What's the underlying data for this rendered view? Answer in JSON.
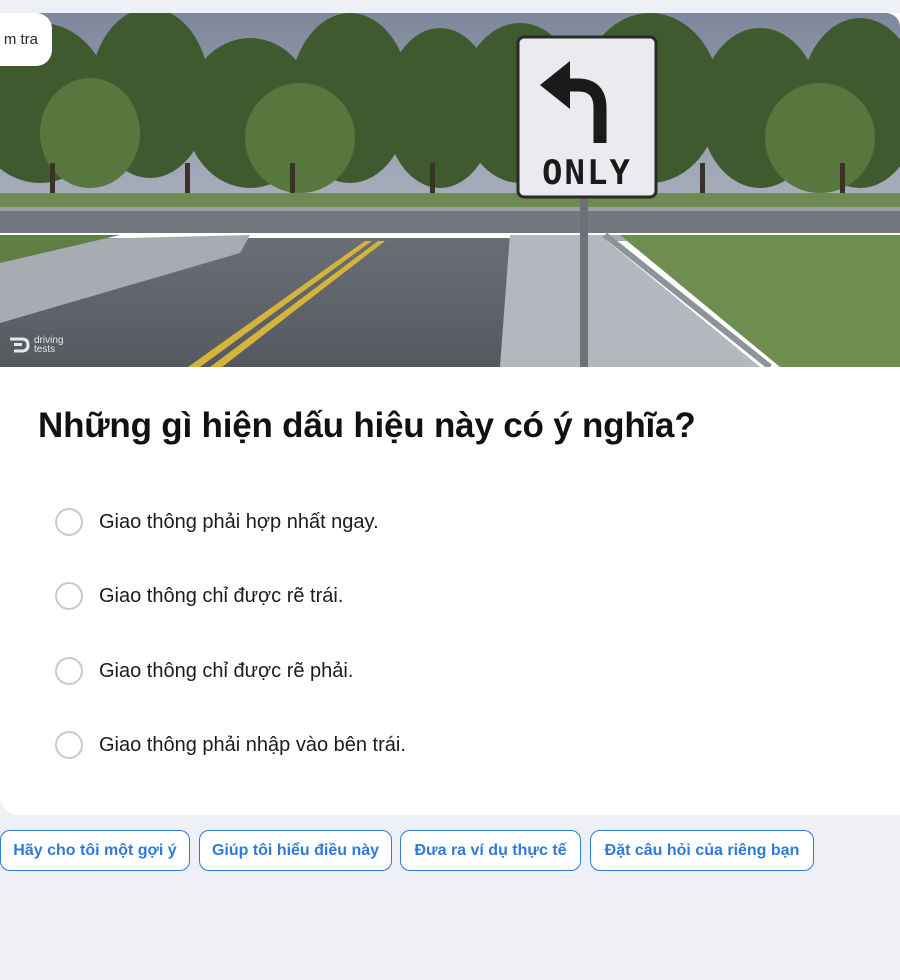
{
  "header": {
    "badge_label": "m tra"
  },
  "image": {
    "sign_text": "ONLY",
    "watermark_line1": "driving",
    "watermark_line2": "tests"
  },
  "question": {
    "text": "Những gì hiện dấu hiệu này có ý nghĩa?"
  },
  "options": [
    {
      "label": "Giao thông phải hợp nhất ngay.",
      "selected": false
    },
    {
      "label": "Giao thông chỉ được rẽ trái.",
      "selected": false
    },
    {
      "label": "Giao thông chỉ được rẽ phải.",
      "selected": false
    },
    {
      "label": "Giao thông phải nhập vào bên trái.",
      "selected": false
    }
  ],
  "suggestions": [
    {
      "label": "Hãy cho tôi một gợi ý"
    },
    {
      "label": "Giúp tôi hiểu điều này"
    },
    {
      "label": "Đưa ra ví dụ thực tế"
    },
    {
      "label": "Đặt câu hỏi của riêng bạn"
    }
  ],
  "colors": {
    "page_background": "#eff0f5",
    "accent": "#2f7bd9",
    "radio_border": "#c8c9d6"
  }
}
